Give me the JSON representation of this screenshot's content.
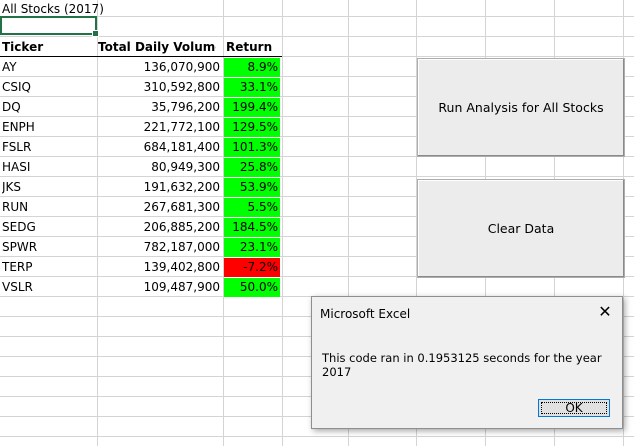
{
  "sheet": {
    "title": "All Stocks (2017)",
    "headers": {
      "ticker": "Ticker",
      "volume": "Total Daily Volume",
      "return": "Return"
    },
    "rows": [
      {
        "ticker": "AY",
        "volume": "136,070,900",
        "return": "8.9%",
        "status": "positive"
      },
      {
        "ticker": "CSIQ",
        "volume": "310,592,800",
        "return": "33.1%",
        "status": "positive"
      },
      {
        "ticker": "DQ",
        "volume": "35,796,200",
        "return": "199.4%",
        "status": "positive"
      },
      {
        "ticker": "ENPH",
        "volume": "221,772,100",
        "return": "129.5%",
        "status": "positive"
      },
      {
        "ticker": "FSLR",
        "volume": "684,181,400",
        "return": "101.3%",
        "status": "positive"
      },
      {
        "ticker": "HASI",
        "volume": "80,949,300",
        "return": "25.8%",
        "status": "positive"
      },
      {
        "ticker": "JKS",
        "volume": "191,632,200",
        "return": "53.9%",
        "status": "positive"
      },
      {
        "ticker": "RUN",
        "volume": "267,681,300",
        "return": "5.5%",
        "status": "positive"
      },
      {
        "ticker": "SEDG",
        "volume": "206,885,200",
        "return": "184.5%",
        "status": "positive"
      },
      {
        "ticker": "SPWR",
        "volume": "782,187,000",
        "return": "23.1%",
        "status": "positive"
      },
      {
        "ticker": "TERP",
        "volume": "139,402,800",
        "return": "-7.2%",
        "status": "negative"
      },
      {
        "ticker": "VSLR",
        "volume": "109,487,900",
        "return": "50.0%",
        "status": "positive"
      }
    ]
  },
  "colors": {
    "positive": "#00ff00",
    "negative": "#ff0000",
    "selection": "#217346"
  },
  "buttons": {
    "run_analysis": "Run Analysis for All Stocks",
    "clear_data": "Clear Data"
  },
  "dialog": {
    "title": "Microsoft Excel",
    "message": "This code ran in 0.1953125 seconds for the year 2017",
    "ok_label": "OK",
    "close_icon": "close-icon"
  }
}
